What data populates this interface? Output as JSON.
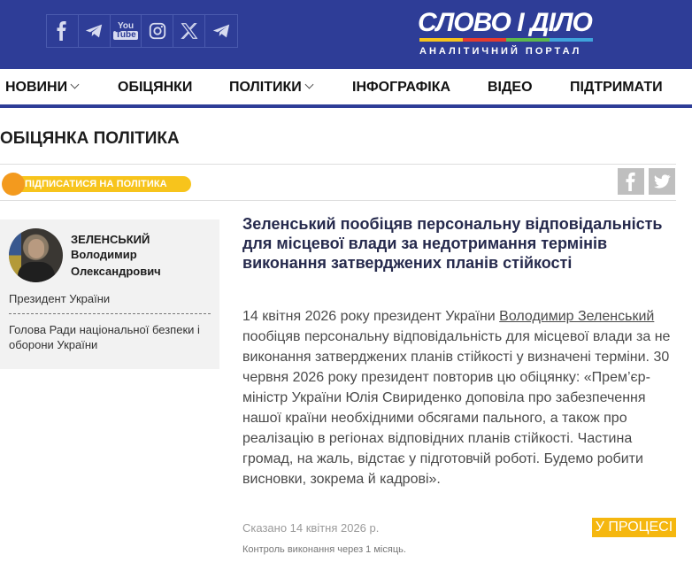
{
  "header": {
    "social": [
      {
        "icon": "facebook-icon"
      },
      {
        "icon": "telegram-icon"
      },
      {
        "icon": "youtube-icon",
        "line1": "You",
        "line2": "Tube"
      },
      {
        "icon": "instagram-icon"
      },
      {
        "icon": "x-icon"
      },
      {
        "icon": "telegram-icon"
      }
    ],
    "logo_main": "СЛОВО І ДІЛО",
    "logo_sub": "АНАЛІТИЧНИЙ ПОРТАЛ",
    "logo_bar_colors": [
      "#f7c41c",
      "#e63b2e",
      "#5db94c",
      "#3fa3dc"
    ]
  },
  "nav": {
    "items": [
      {
        "label": "НОВИНИ"
      },
      {
        "label": "ОБІЦЯНКИ"
      },
      {
        "label": "ПОЛІТИКИ"
      },
      {
        "label": "ІНФОГРАФІКА"
      },
      {
        "label": "ВІДЕО"
      },
      {
        "label": "ПІДТРИМАТИ"
      }
    ]
  },
  "page": {
    "title": "ОБІЦЯНКА ПОЛІТИКА",
    "subscribe_label": "ПІДПИСАТИСЯ НА ПОЛІТИКА"
  },
  "politician": {
    "surname": "ЗЕЛЕНСЬКИЙ",
    "first_name": "Володимир",
    "patronymic": "Олександрович",
    "role1": "Президент України",
    "role2": "Голова Ради національної безпеки і оборони України"
  },
  "article": {
    "headline": "Зеленський пообіцяв персональну відповідальність для місцевої влади за недотримання термінів виконання затверджених планів стійкості",
    "body_before_link": "14 квітня 2026 року президент України ",
    "body_link": "Володимир Зеленський",
    "body_after_link": " пообіцяв персональну відповідальність для місцевої влади за не виконання затверджених планів стійкості у визначені терміни. 30 червня 2026 року президент повторив цю обіцянку: «Прем’єр-міністр України Юлія Свириденко доповіла про забезпечення нашої країни необхідними обсягами пального, а також про реалізацію в регіонах відповідних планів стійкості. Частина громад, на жаль, відстає у підготовчій роботі. Будемо робити висновки, зокрема й кадрові».",
    "said": "Сказано 14 квітня 2026 р.",
    "status": "У ПРОЦЕСІ",
    "control": "Контроль виконання через 1 місяць."
  },
  "colors": {
    "header_bg": "#2e3d97",
    "accent_yellow": "#f5b70f",
    "subscribe_orange": "#f39a1e"
  }
}
